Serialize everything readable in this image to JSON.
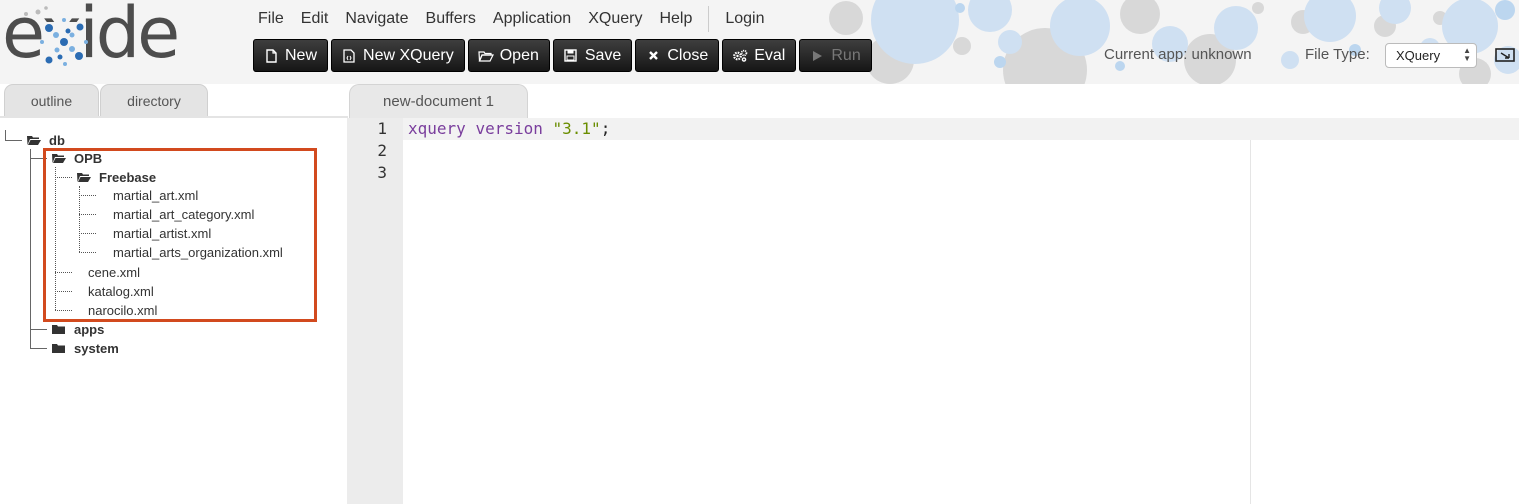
{
  "app": {
    "logo_text": "exide"
  },
  "menu": [
    "File",
    "Edit",
    "Navigate",
    "Buffers",
    "Application",
    "XQuery",
    "Help",
    "Login"
  ],
  "toolbar": {
    "new": "New",
    "new_xquery": "New XQuery",
    "open": "Open",
    "save": "Save",
    "close": "Close",
    "eval": "Eval",
    "run": "Run"
  },
  "status": {
    "current_app": "Current app: unknown",
    "file_type_label": "File Type:",
    "file_type_value": "XQuery"
  },
  "side_tabs": {
    "outline": "outline",
    "directory": "directory"
  },
  "tree": {
    "db": "db",
    "opb": "OPB",
    "freebase": "Freebase",
    "freebase_files": [
      "martial_art.xml",
      "martial_art_category.xml",
      "martial_artist.xml",
      "martial_arts_organization.xml"
    ],
    "opb_files": [
      "cene.xml",
      "katalog.xml",
      "narocilo.xml"
    ],
    "apps": "apps",
    "system": "system"
  },
  "editor": {
    "tab_title": "new-document 1",
    "line_numbers": [
      "1",
      "2",
      "3"
    ],
    "code": {
      "keyword1": "xquery",
      "keyword2": "version",
      "string": "\"3.1\"",
      "punct": ";"
    }
  },
  "colors": {
    "highlight_box": "#d24a1e",
    "keyword": "#7a3e9d",
    "string": "#6a8d00",
    "toolbar": "#222222"
  }
}
